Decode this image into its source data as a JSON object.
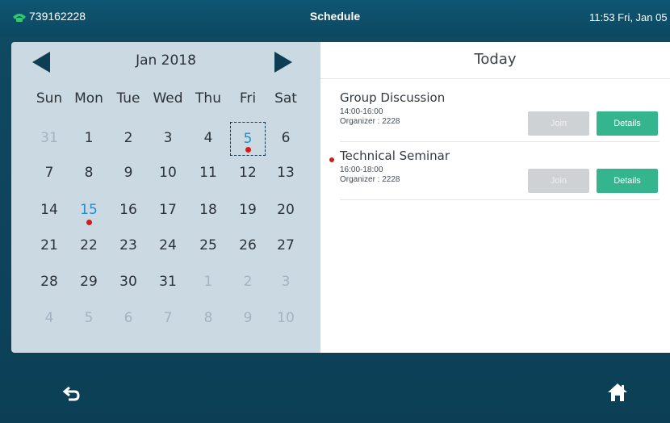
{
  "topbar": {
    "phone_number": "739162228",
    "title": "Schedule",
    "clock": "11:53 Fri, Jan 05"
  },
  "calendar": {
    "month_label": "Jan 2018",
    "weekdays": [
      "Sun",
      "Mon",
      "Tue",
      "Wed",
      "Thu",
      "Fri",
      "Sat"
    ],
    "weeks": [
      [
        {
          "d": "31",
          "m": true
        },
        {
          "d": "1"
        },
        {
          "d": "2"
        },
        {
          "d": "3"
        },
        {
          "d": "4"
        },
        {
          "d": "5",
          "today": true,
          "event": true
        },
        {
          "d": "6"
        }
      ],
      [
        {
          "d": "7"
        },
        {
          "d": "8"
        },
        {
          "d": "9"
        },
        {
          "d": "10"
        },
        {
          "d": "11"
        },
        {
          "d": "12"
        },
        {
          "d": "13"
        }
      ],
      [
        {
          "d": "14"
        },
        {
          "d": "15",
          "sel": true,
          "event": true
        },
        {
          "d": "16"
        },
        {
          "d": "17"
        },
        {
          "d": "18"
        },
        {
          "d": "19"
        },
        {
          "d": "20"
        }
      ],
      [
        {
          "d": "21"
        },
        {
          "d": "22"
        },
        {
          "d": "23"
        },
        {
          "d": "24"
        },
        {
          "d": "25"
        },
        {
          "d": "26"
        },
        {
          "d": "27"
        }
      ],
      [
        {
          "d": "28"
        },
        {
          "d": "29"
        },
        {
          "d": "30"
        },
        {
          "d": "31"
        },
        {
          "d": "1",
          "m": true
        },
        {
          "d": "2",
          "m": true
        },
        {
          "d": "3",
          "m": true
        }
      ],
      [
        {
          "d": "4",
          "m": true
        },
        {
          "d": "5",
          "m": true
        },
        {
          "d": "6",
          "m": true
        },
        {
          "d": "7",
          "m": true
        },
        {
          "d": "8",
          "m": true
        },
        {
          "d": "9",
          "m": true
        },
        {
          "d": "10",
          "m": true
        }
      ]
    ]
  },
  "today_panel": {
    "heading": "Today",
    "events": [
      {
        "name": "Group Discussion",
        "time": "14:00-16:00",
        "organizer": "Organizer : 2228",
        "join_label": "Join",
        "details_label": "Details",
        "has_dot": false
      },
      {
        "name": "Technical Seminar",
        "time": "16:00-18:00",
        "organizer": "Organizer : 2228",
        "join_label": "Join",
        "details_label": "Details",
        "has_dot": true
      }
    ]
  },
  "colors": {
    "accent_green": "#35b58e",
    "event_dot": "#d31b1b",
    "selected_day": "#1f8fd6",
    "topbar": "#0f5673"
  }
}
